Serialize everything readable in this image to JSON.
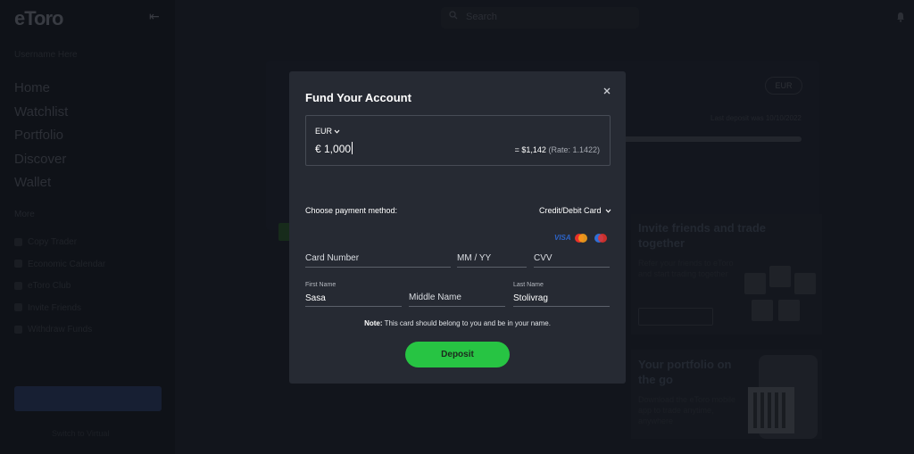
{
  "app": {
    "logo": "eToro",
    "username": "Username Here",
    "search_placeholder": "Search"
  },
  "sidebar": {
    "items": [
      {
        "label": "Home"
      },
      {
        "label": "Watchlist"
      },
      {
        "label": "Portfolio"
      },
      {
        "label": "Discover"
      },
      {
        "label": "Wallet"
      }
    ],
    "section_title": "More",
    "sub_items": [
      {
        "label": "Copy Trader"
      },
      {
        "label": "Economic Calendar"
      },
      {
        "label": "eToro Club"
      },
      {
        "label": "Invite Friends"
      },
      {
        "label": "Withdraw Funds"
      }
    ],
    "footer": "Switch to Virtual"
  },
  "background": {
    "currency_pill": "EUR",
    "note": "Last deposit was 10/10/2022",
    "promo_invite": {
      "title": "Invite friends and trade together",
      "text": "Refer your friends to eToro and start trading together",
      "button": "Invite"
    },
    "promo_mobile": {
      "title": "Your portfolio on the go",
      "text": "Download the eToro mobile app to trade anytime, anywhere"
    }
  },
  "modal": {
    "title": "Fund Your Account",
    "currency": "EUR",
    "amount": "€ 1,000",
    "conversion": "= $1,142",
    "rate": "(Rate: 1.1422)",
    "payment_label": "Choose payment method:",
    "payment_method": "Credit/Debit Card",
    "card_brands": [
      "VISA",
      "Mastercard",
      "Maestro"
    ],
    "fields": {
      "card_number_placeholder": "Card Number",
      "expiry_placeholder": "MM / YY",
      "cvv_placeholder": "CVV",
      "first_name_label": "First Name",
      "first_name_value": "Sasa",
      "middle_name_placeholder": "Middle Name",
      "last_name_label": "Last Name",
      "last_name_value": "Stolivrag"
    },
    "note_label": "Note:",
    "note_text": " This card should belong to you and be in your name.",
    "deposit_label": "Deposit"
  },
  "colors": {
    "modal_bg": "#262a33",
    "page_bg": "#181c26",
    "accent_green": "#27c443",
    "visa_blue": "#2d63c6"
  }
}
